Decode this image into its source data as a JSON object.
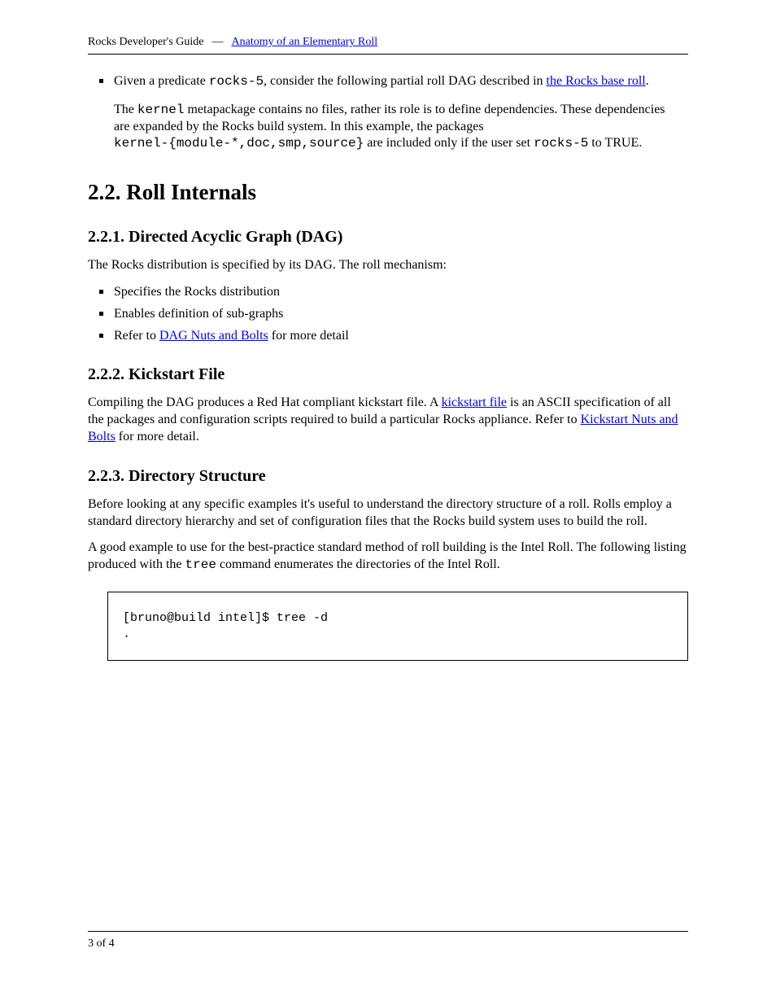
{
  "header": {
    "left": "Rocks Developer's Guide",
    "link_text": "Anatomy of an Elementary Roll",
    "separator": "—"
  },
  "footer": {
    "left": "3 of 4"
  },
  "bullet1": {
    "prefix": "Given a predicate ",
    "code1": "rocks-5",
    "mid": ", consider the following partial roll DAG described in ",
    "link_text": "the Rocks base roll",
    "suffix": "."
  },
  "dag_para": {
    "l1_pre": "The ",
    "l1_code": "kernel",
    "l1_post": " metapackage contains no files, rather its role is to define dependencies. These dependencies"
  },
  "l2": "are expanded by the Rocks build system. In this example, the packages",
  "l3_pre": "",
  "l3_code1": "kernel-{module-*,doc,smp,source}",
  "l3_mid": " are included only if the user set ",
  "l3_code2": "rocks-5",
  "l3_post": " to TRUE.",
  "section_heading": "2.2. Roll Internals",
  "subsection_heading": "2.2.1. Directed Acyclic Graph (DAG)",
  "list2_intro": "The Rocks distribution is specified by its DAG. The roll mechanism:",
  "list2_items": [
    "Specifies the Rocks distribution",
    "Enables definition of sub-graphs",
    {
      "pre": "Refer to ",
      "link": "DAG Nuts and Bolts",
      "post": " for more detail"
    }
  ],
  "subsection_heading2": "2.2.2. Kickstart File",
  "ks_para_l1_pre": "Compiling the DAG produces a Red Hat compliant kickstart file. A ",
  "ks_para_l1_link": "kickstart file",
  "ks_para_l1_post": " is an",
  "ks_para_l2": "ASCII specification of all the packages and configuration scripts required to build a particular Rocks appliance.",
  "ks_para_l3_pre": "Refer to ",
  "ks_para_l3_link": "Kickstart Nuts and Bolts",
  "ks_para_l3_post": " for more detail.",
  "subsection_heading3": "2.2.3. Directory Structure",
  "dir_para": "Before looking at any specific examples it's useful to understand the directory structure of a roll. Rolls employ a standard directory hierarchy and set of configuration files that the Rocks build system uses to build the roll.",
  "dir_para2_l1": "A good example to use for the best-practice standard method of roll building is the Intel Roll. The following",
  "dir_para2_l2_pre": "listing produced with the ",
  "dir_para2_l2_code": "tree",
  "dir_para2_l2_post": " command enumerates the directories of the Intel Roll.",
  "codebox": {
    "line1": "[bruno@build intel]$ tree -d",
    "line2": "."
  }
}
